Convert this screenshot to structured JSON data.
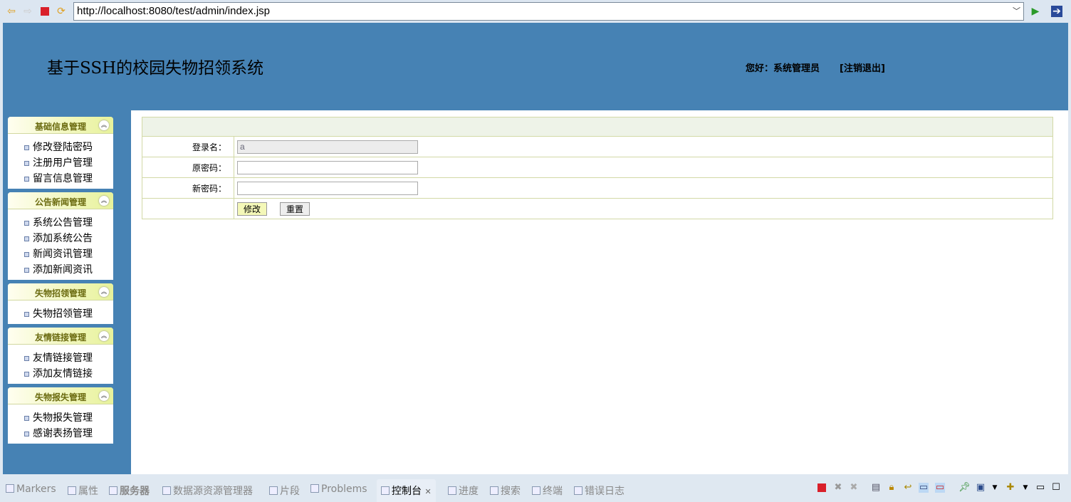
{
  "browser": {
    "url": "http://localhost:8080/test/admin/index.jsp"
  },
  "header": {
    "title": "基于SSH的校园失物招领系统",
    "greeting": "您好：系统管理员",
    "logout": "[注销退出]"
  },
  "sidebar": [
    {
      "title": "基础信息管理",
      "items": [
        "修改登陆密码",
        "注册用户管理",
        "留言信息管理"
      ]
    },
    {
      "title": "公告新闻管理",
      "items": [
        "系统公告管理",
        "添加系统公告",
        "新闻资讯管理",
        "添加新闻资讯"
      ]
    },
    {
      "title": "失物招领管理",
      "items": [
        "失物招领管理"
      ]
    },
    {
      "title": "友情链接管理",
      "items": [
        "友情链接管理",
        "添加友情链接"
      ]
    },
    {
      "title": "失物报失管理",
      "items": [
        "失物报失管理",
        "感谢表扬管理"
      ]
    }
  ],
  "form": {
    "login_label": "登录名：",
    "login_value": "a",
    "old_label": "原密码：",
    "new_label": "新密码：",
    "submit": "修改",
    "reset": "重置"
  },
  "bottom_tabs": [
    "Markers",
    "属性",
    "服务器",
    "数据源资源管理器",
    "片段",
    "Problems",
    "控制台",
    "进度",
    "搜索",
    "终端",
    "错误日志"
  ]
}
